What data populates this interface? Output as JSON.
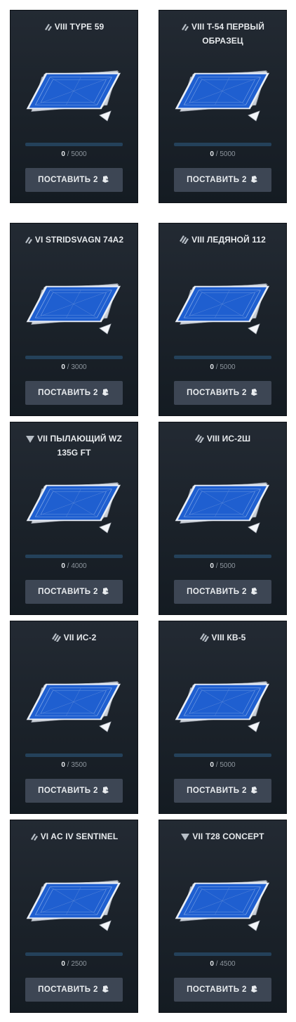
{
  "cards": [
    {
      "tier": "VIII",
      "name": "TYPE 59",
      "class_icon": "medium-tank-icon",
      "progress_current": "0",
      "progress_total": "5000",
      "button_label": "ПОСТАВИТЬ 2"
    },
    {
      "tier": "VIII",
      "name": "T-54 ПЕРВЫЙ ОБРАЗЕЦ",
      "class_icon": "medium-tank-icon",
      "progress_current": "0",
      "progress_total": "5000",
      "button_label": "ПОСТАВИТЬ 2"
    },
    {
      "tier": "VI",
      "name": "STRIDSVAGN 74A2",
      "class_icon": "medium-tank-icon",
      "progress_current": "0",
      "progress_total": "3000",
      "button_label": "ПОСТАВИТЬ 2"
    },
    {
      "tier": "VIII",
      "name": "ЛЕДЯНОЙ 112",
      "class_icon": "heavy-tank-icon",
      "progress_current": "0",
      "progress_total": "5000",
      "button_label": "ПОСТАВИТЬ 2"
    },
    {
      "tier": "VII",
      "name": "ПЫЛАЮЩИЙ WZ 135G FT",
      "class_icon": "tank-destroyer-icon",
      "progress_current": "0",
      "progress_total": "4000",
      "button_label": "ПОСТАВИТЬ 2"
    },
    {
      "tier": "VIII",
      "name": "ИС-2Ш",
      "class_icon": "heavy-tank-icon",
      "progress_current": "0",
      "progress_total": "5000",
      "button_label": "ПОСТАВИТЬ 2"
    },
    {
      "tier": "VII",
      "name": "ИС-2",
      "class_icon": "heavy-tank-icon",
      "progress_current": "0",
      "progress_total": "3500",
      "button_label": "ПОСТАВИТЬ 2"
    },
    {
      "tier": "VIII",
      "name": "КВ-5",
      "class_icon": "heavy-tank-icon",
      "progress_current": "0",
      "progress_total": "5000",
      "button_label": "ПОСТАВИТЬ 2"
    },
    {
      "tier": "VI",
      "name": "AC IV SENTINEL",
      "class_icon": "medium-tank-icon",
      "progress_current": "0",
      "progress_total": "2500",
      "button_label": "ПОСТАВИТЬ 2"
    },
    {
      "tier": "VII",
      "name": "T28 CONCEPT",
      "class_icon": "tank-destroyer-icon",
      "progress_current": "0",
      "progress_total": "4500",
      "button_label": "ПОСТАВИТЬ 2"
    }
  ],
  "colors": {
    "card_bg": "#1c232b",
    "progress_track": "#24415a",
    "progress_fill": "#3d88c9",
    "button_bg": "#3d4654",
    "blueprint": "#1f5fd0"
  }
}
